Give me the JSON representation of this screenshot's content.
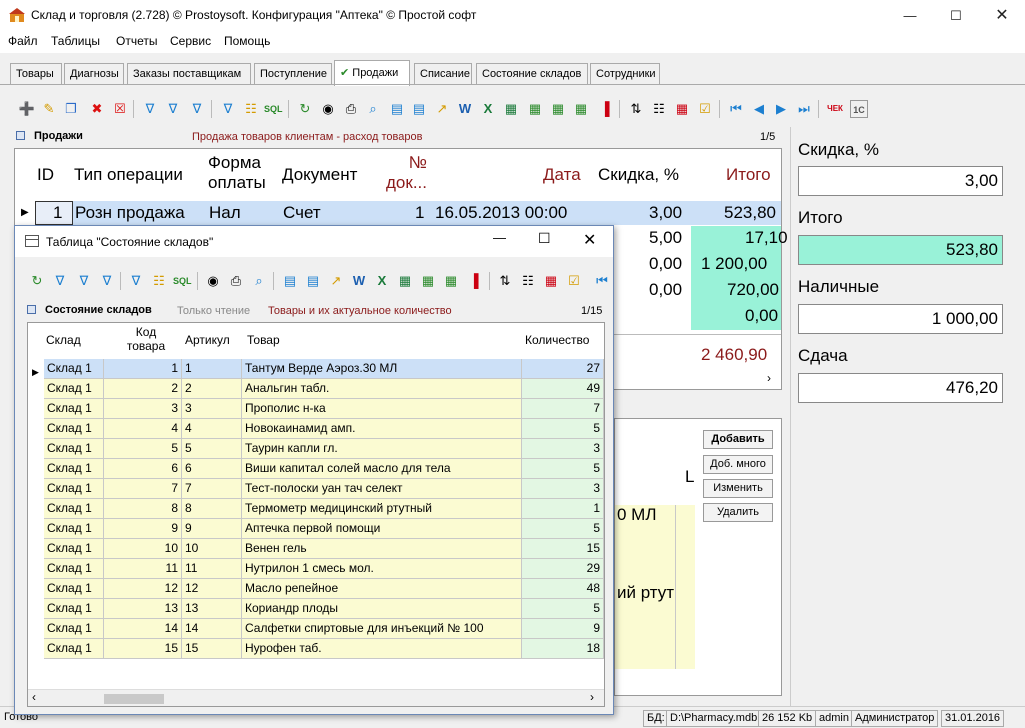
{
  "window": {
    "title": "Склад и торговля (2.728) © Prostoysoft. Конфигурация \"Аптека\" © Простой софт"
  },
  "menu": [
    "Файл",
    "Таблицы",
    "Отчеты",
    "Сервис",
    "Помощь"
  ],
  "tabs": [
    "Товары",
    "Диагнозы",
    "Заказы поставщикам",
    "Поступление",
    "Продажи",
    "Списание",
    "Состояние складов",
    "Сотрудники"
  ],
  "sales": {
    "header_title": "Продажи",
    "header_desc": "Продажа товаров клиентам - расход товаров",
    "page": "1/5",
    "columns": {
      "id": "ID",
      "op": "Тип операции",
      "pay": "Форма оплаты",
      "doc": "Документ",
      "docno": "№ док...",
      "date": "Дата",
      "disc": "Скидка, %",
      "total": "Итого"
    },
    "row": {
      "id": "1",
      "op": "Розн продажа",
      "pay": "Нал",
      "doc": "Счет",
      "docno": "1",
      "date": "16.05.2013 00:00",
      "disc": "3,00",
      "total": "523,80"
    },
    "disc_values": [
      "5,00",
      "0,00",
      "0,00"
    ],
    "total_values": [
      "17,10",
      "1 200,00",
      "720,00",
      "0,00"
    ],
    "sum": "2 460,90"
  },
  "right": {
    "disc_label": "Скидка, %",
    "disc_value": "3,00",
    "total_label": "Итого",
    "total_value": "523,80",
    "cash_label": "Наличные",
    "cash_value": "1 000,00",
    "change_label": "Сдача",
    "change_value": "476,20"
  },
  "lower": {
    "buttons": [
      "Добавить",
      "Доб. много",
      "Изменить",
      "Удалить"
    ],
    "partial_a": "L",
    "partial_b": "0 МЛ",
    "partial_c": "ий ртут"
  },
  "status": {
    "left": "Готово",
    "db_label": "БД:",
    "db_path": "D:\\Pharmacy.mdb",
    "size": "26 152 Kb",
    "user": "admin",
    "role": "Администратор",
    "date": "31.01.2016"
  },
  "popup": {
    "title": "Таблица \"Состояние складов\"",
    "panel_title": "Состояние складов",
    "readonly": "Только чтение",
    "desc": "Товары и их актуальное количество",
    "page": "1/15",
    "columns": {
      "store": "Склад",
      "code": "Код товара",
      "art": "Артикул",
      "name": "Товар",
      "qty": "Количество"
    },
    "rows": [
      {
        "store": "Склад 1",
        "code": "1",
        "art": "1",
        "name": "Тантум Верде Аэроз.30 МЛ",
        "qty": "27"
      },
      {
        "store": "Склад 1",
        "code": "2",
        "art": "2",
        "name": "Анальгин табл.",
        "qty": "49"
      },
      {
        "store": "Склад 1",
        "code": "3",
        "art": "3",
        "name": "Прополис н-ка",
        "qty": "7"
      },
      {
        "store": "Склад 1",
        "code": "4",
        "art": "4",
        "name": "Новокаинамид амп.",
        "qty": "5"
      },
      {
        "store": "Склад 1",
        "code": "5",
        "art": "5",
        "name": "Таурин капли гл.",
        "qty": "3"
      },
      {
        "store": "Склад 1",
        "code": "6",
        "art": "6",
        "name": "Виши капитал солей масло  для тела",
        "qty": "5"
      },
      {
        "store": "Склад 1",
        "code": "7",
        "art": "7",
        "name": "Тест-полоски уан тач селект",
        "qty": "3"
      },
      {
        "store": "Склад 1",
        "code": "8",
        "art": "8",
        "name": "Термометр медицинский ртутный",
        "qty": "1"
      },
      {
        "store": "Склад 1",
        "code": "9",
        "art": "9",
        "name": "Аптечка первой помощи",
        "qty": "5"
      },
      {
        "store": "Склад 1",
        "code": "10",
        "art": "10",
        "name": "Венен гель",
        "qty": "15"
      },
      {
        "store": "Склад 1",
        "code": "11",
        "art": "11",
        "name": "Нутрилон 1 смесь мол.",
        "qty": "29"
      },
      {
        "store": "Склад 1",
        "code": "12",
        "art": "12",
        "name": "Масло репейное",
        "qty": "48"
      },
      {
        "store": "Склад 1",
        "code": "13",
        "art": "13",
        "name": "Кориандр плоды",
        "qty": "5"
      },
      {
        "store": "Склад 1",
        "code": "14",
        "art": "14",
        "name": "Салфетки спиртовые для инъекций № 100",
        "qty": "9"
      },
      {
        "store": "Склад 1",
        "code": "15",
        "art": "15",
        "name": "Нурофен таб.",
        "qty": "18"
      }
    ]
  },
  "colors": {
    "selection": "#cce0f7",
    "green": "#99f2d8",
    "yellow_row": "#fbfbd2",
    "qty_green": "#e3f7e3",
    "darkred": "#8b1a1a"
  }
}
